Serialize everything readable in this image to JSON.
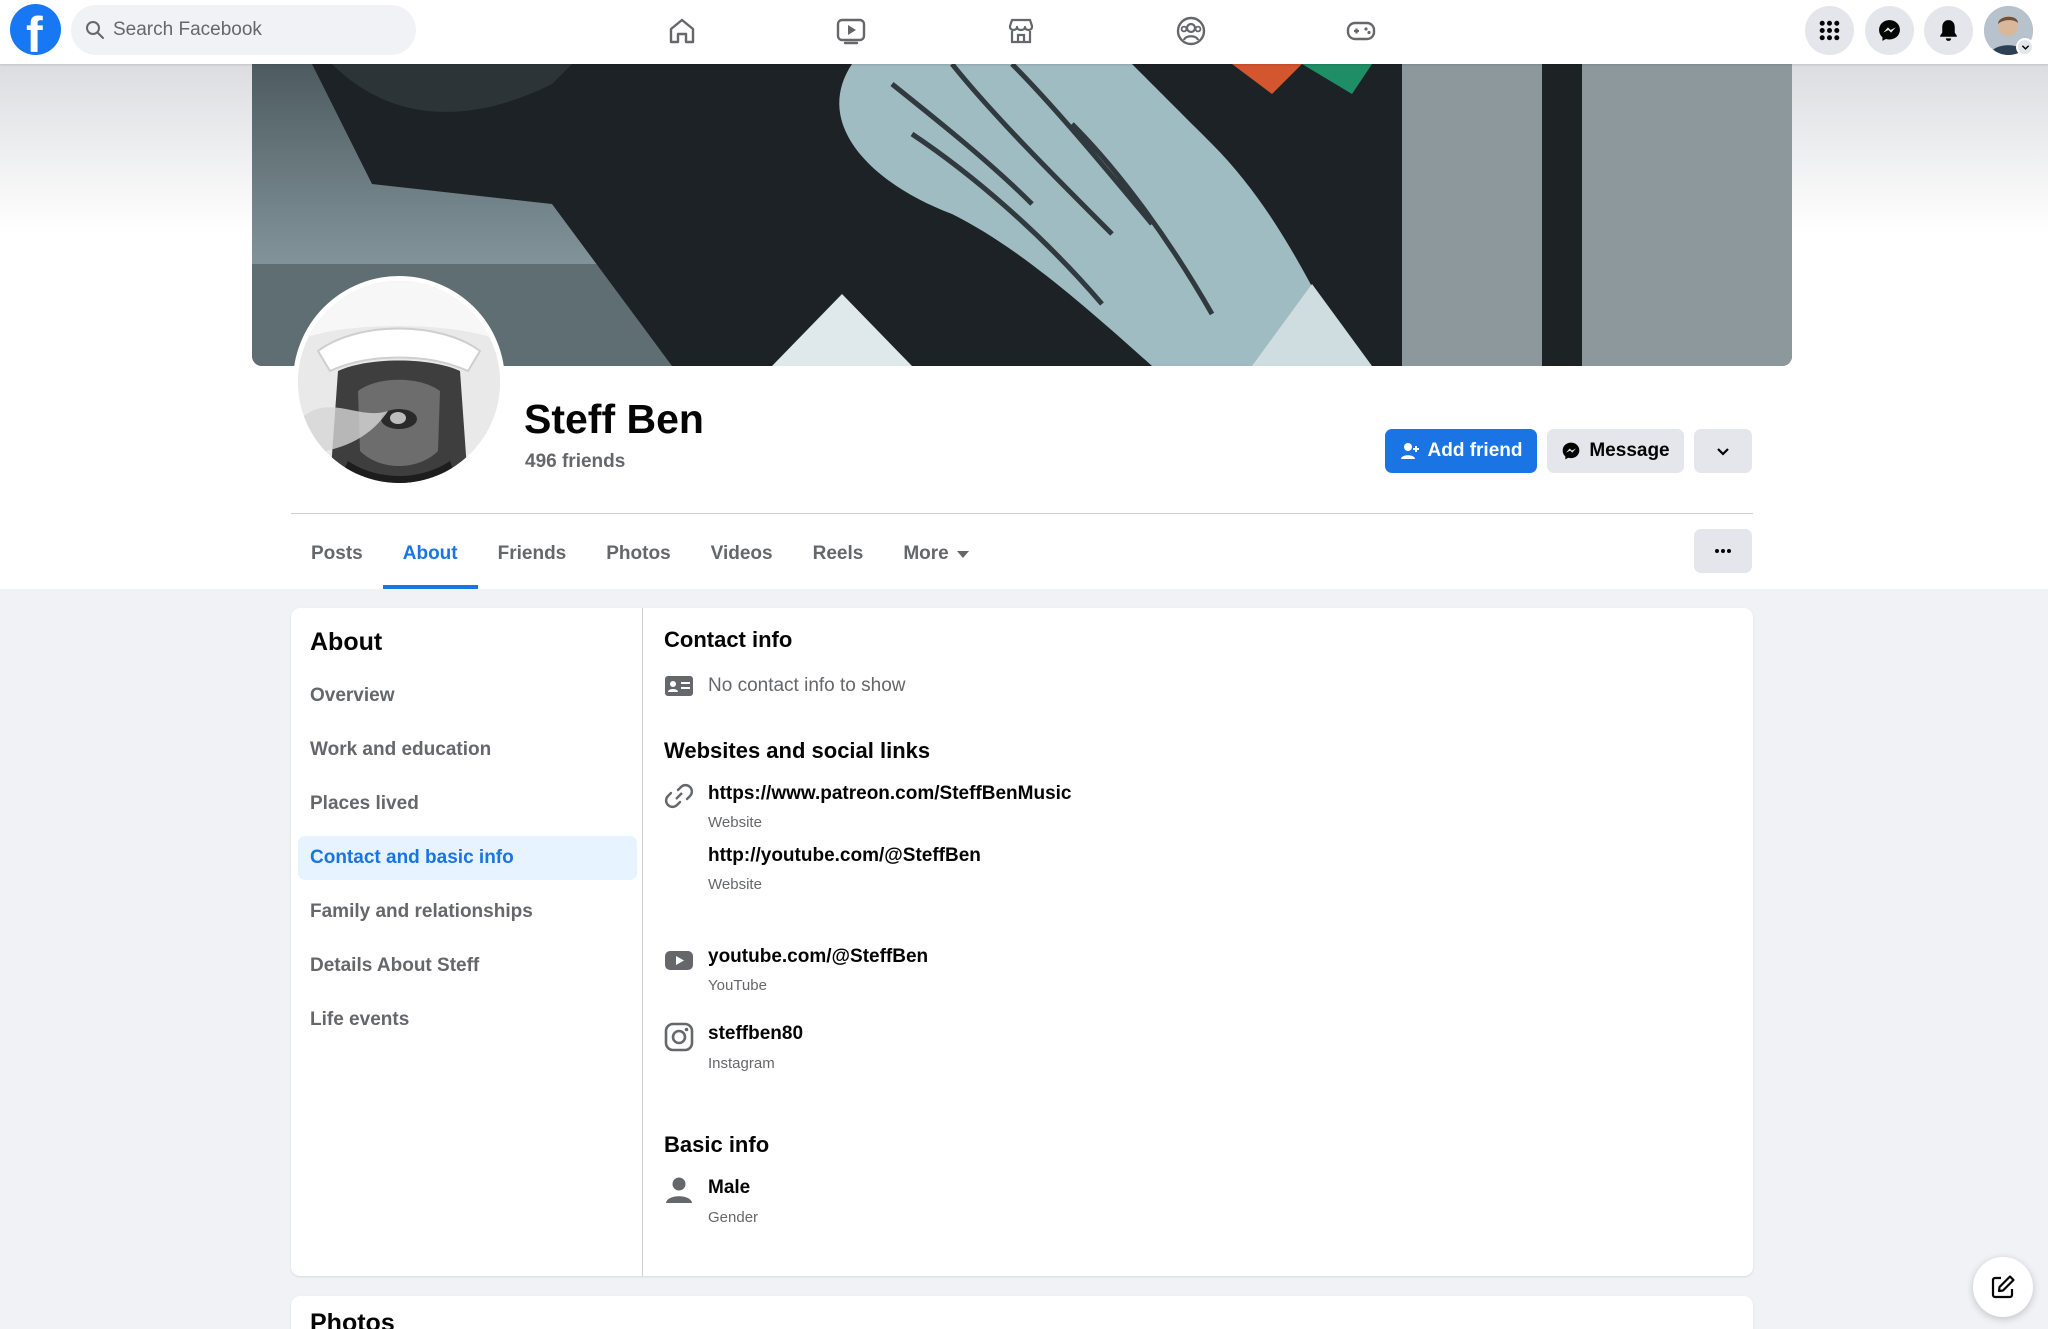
{
  "colors": {
    "brand": "#1877f2",
    "accent": "#1b74e4",
    "accent_light": "#e7f3ff",
    "text_primary": "#050505",
    "text_secondary": "#65676b",
    "surface": "#e4e6eb",
    "background": "#f0f2f5"
  },
  "topbar": {
    "logo_icon": "facebook-logo",
    "search": {
      "placeholder": "Search Facebook",
      "value": ""
    },
    "nav": [
      "home-icon",
      "watch-icon",
      "marketplace-icon",
      "groups-icon",
      "gaming-icon"
    ],
    "actions": [
      "menu-grid-icon",
      "messenger-icon",
      "notifications-icon",
      "account-avatar"
    ]
  },
  "profile": {
    "name": "Steff Ben",
    "friends": "496 friends",
    "add_friend_label": "Add friend",
    "message_label": "Message",
    "tabs": [
      {
        "label": "Posts"
      },
      {
        "label": "About",
        "active": true
      },
      {
        "label": "Friends"
      },
      {
        "label": "Photos"
      },
      {
        "label": "Videos"
      },
      {
        "label": "Reels"
      },
      {
        "label": "More"
      }
    ]
  },
  "about": {
    "title": "About",
    "menu": [
      {
        "label": "Overview"
      },
      {
        "label": "Work and education"
      },
      {
        "label": "Places lived"
      },
      {
        "label": "Contact and basic info",
        "active": true
      },
      {
        "label": "Family and relationships"
      },
      {
        "label": "Details About Steff"
      },
      {
        "label": "Life events"
      }
    ],
    "contact_title": "Contact info",
    "contact_empty": "No contact info to show",
    "websites_title": "Websites and social links",
    "websites": [
      {
        "value": "https://www.patreon.com/SteffBenMusic",
        "type": "Website"
      },
      {
        "value": "http://youtube.com/@SteffBen",
        "type": "Website"
      }
    ],
    "social": [
      {
        "value": "youtube.com/@SteffBen",
        "type": "YouTube",
        "icon": "youtube-icon"
      },
      {
        "value": "steffben80",
        "type": "Instagram",
        "icon": "instagram-icon"
      }
    ],
    "basic_title": "Basic info",
    "basic": [
      {
        "value": "Male",
        "type": "Gender",
        "icon": "person-icon"
      }
    ]
  },
  "photos_section": {
    "title": "Photos"
  }
}
